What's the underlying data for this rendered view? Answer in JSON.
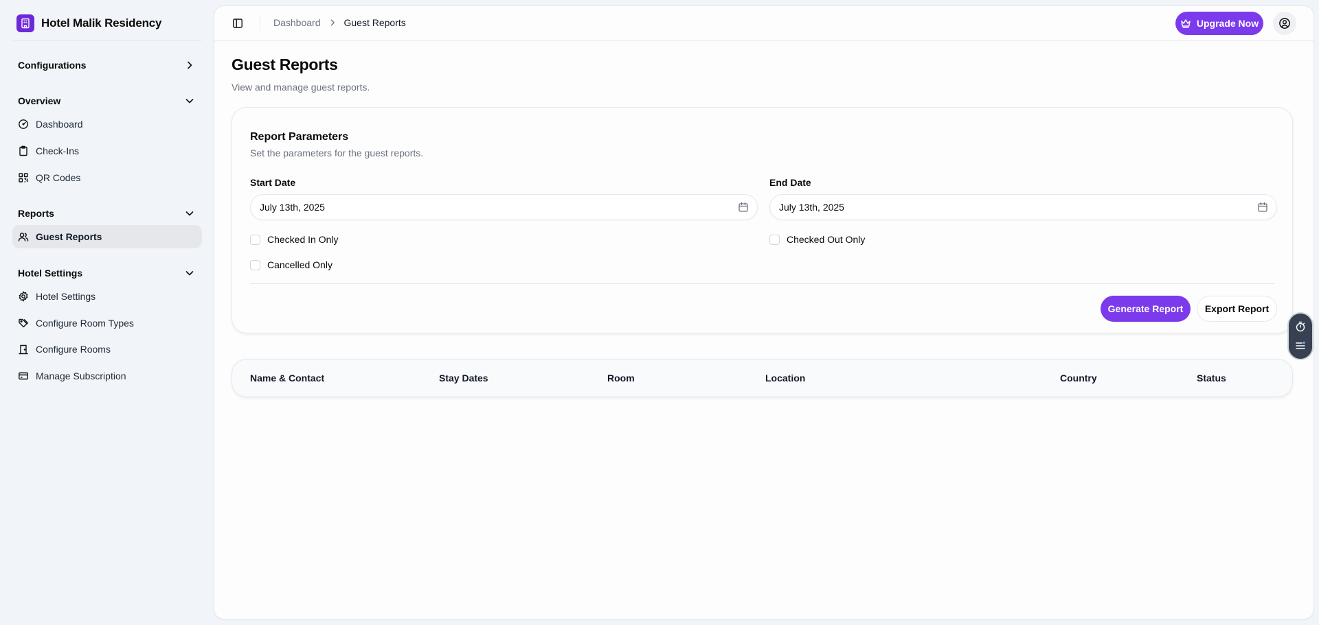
{
  "sidebar": {
    "brand": "Hotel Malik Residency",
    "groups": {
      "configurations": "Configurations",
      "overview": "Overview",
      "reports": "Reports",
      "hotel_settings": "Hotel Settings"
    },
    "items": {
      "dashboard": "Dashboard",
      "checkins": "Check-Ins",
      "qrcodes": "QR Codes",
      "guest_reports": "Guest Reports",
      "hotel_settings": "Hotel Settings",
      "room_types": "Configure Room Types",
      "rooms": "Configure Rooms",
      "subscription": "Manage Subscription"
    }
  },
  "topbar": {
    "breadcrumb": [
      "Dashboard",
      "Guest Reports"
    ],
    "upgrade_label": "Upgrade Now"
  },
  "page": {
    "title": "Guest Reports",
    "subtitle": "View and manage guest reports."
  },
  "report_params": {
    "title": "Report Parameters",
    "subtitle": "Set the parameters for the guest reports.",
    "start_label": "Start Date",
    "start_value": "July 13th, 2025",
    "end_label": "End Date",
    "end_value": "July 13th, 2025",
    "checks": {
      "checked_in": "Checked In Only",
      "checked_out": "Checked Out Only",
      "cancelled": "Cancelled Only"
    },
    "generate_label": "Generate Report",
    "export_label": "Export Report"
  },
  "table": {
    "columns": [
      "Name & Contact",
      "Stay Dates",
      "Room",
      "Location",
      "Country",
      "Status"
    ]
  },
  "colors": {
    "accent": "#7c3aed",
    "background": "#f1f5f9"
  }
}
